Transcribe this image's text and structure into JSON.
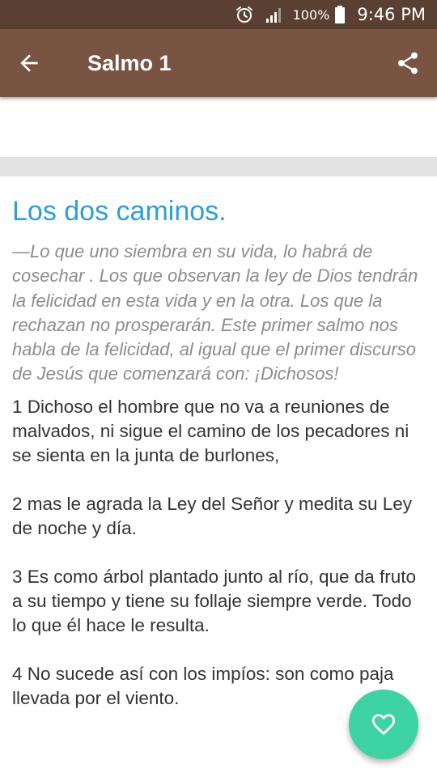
{
  "status_bar": {
    "battery_percent": "100%",
    "time": "9:46 PM",
    "icons": [
      "alarm-icon",
      "signal-icon",
      "battery-icon"
    ]
  },
  "app_bar": {
    "title": "Salmo 1",
    "back_icon": "arrow-left-icon",
    "share_icon": "share-icon",
    "background_color": "#7a5443",
    "status_color": "#5a4032"
  },
  "content": {
    "heading": "Los dos caminos.",
    "intro": "—Lo que uno siembra en su vida, lo habrá de cosechar . Los que observan la ley de Dios tendrán la felicidad en esta vida y en la otra. Los que la rechazan no prosperarán. Este primer salmo nos habla de la felicidad, al igual que el primer discurso de Jesús que comenzará con: ¡Dichosos!",
    "verses": [
      "1 Dichoso el hombre que no va a reuniones de malvados, ni sigue el camino de los pecadores ni se sienta en la junta de burlones,",
      "2 mas le agrada la Ley del Señor y medita su Ley de noche y día.",
      "3 Es como árbol plantado junto al río, que da fruto a su tiempo y tiene su follaje siempre verde. Todo lo que él hace le resulta.",
      "4 No sucede así con los impíos: son como paja llevada por el viento."
    ],
    "heading_color": "#2e9fd6"
  },
  "fab": {
    "icon": "heart-outline-icon",
    "color": "#3dd3a3"
  }
}
